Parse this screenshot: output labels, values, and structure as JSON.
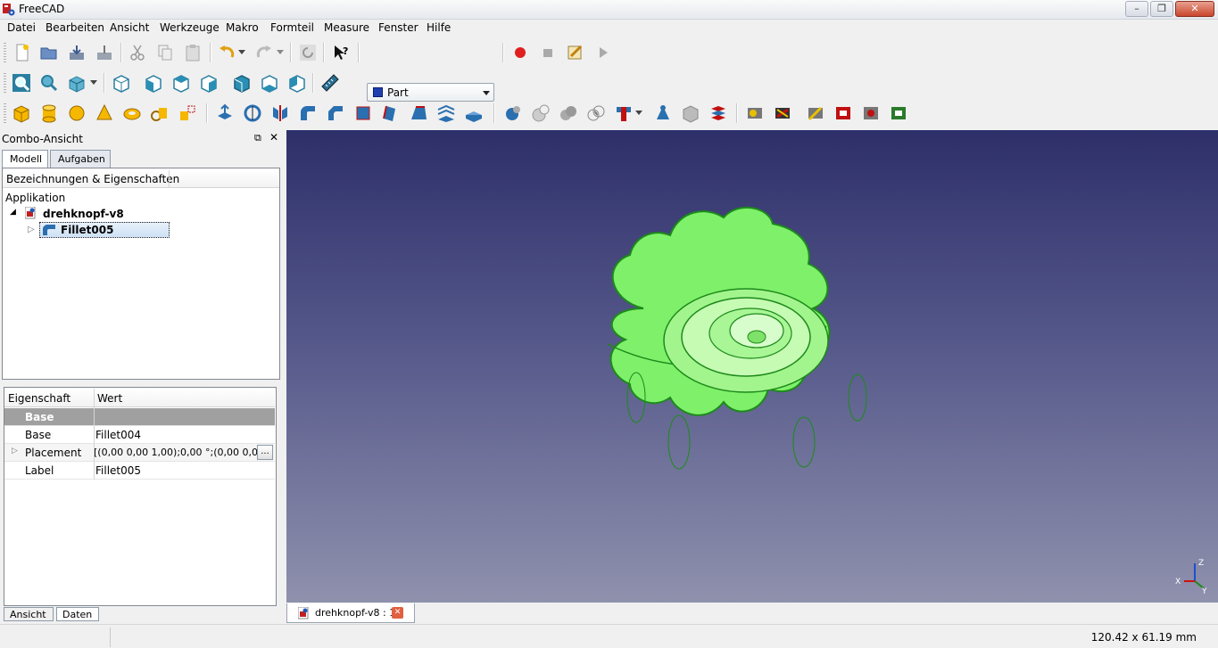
{
  "window": {
    "title": "FreeCAD"
  },
  "menu": [
    "Datei",
    "Bearbeiten",
    "Ansicht",
    "Werkzeuge",
    "Makro",
    "Formteil",
    "Measure",
    "Fenster",
    "Hilfe"
  ],
  "workbench": {
    "selected": "Part"
  },
  "combo": {
    "title": "Combo-Ansicht",
    "tabs": [
      "Modell",
      "Aufgaben"
    ]
  },
  "tree": {
    "header": "Bezeichnungen & Eigenschaften",
    "root": "Applikation",
    "document": "drehknopf-v8",
    "object": "Fillet005"
  },
  "properties": {
    "col_property": "Eigenschaft",
    "col_value": "Wert",
    "group": "Base",
    "rows": [
      {
        "name": "Base",
        "value": "Fillet004"
      },
      {
        "name": "Placement",
        "value": "[(0,00 0,00 1,00);0,00 °;(0,00 0,00 0,0"
      },
      {
        "name": "Label",
        "value": "Fillet005"
      }
    ],
    "ellipsis": "..."
  },
  "bottom_tabs": [
    "Ansicht",
    "Daten"
  ],
  "doc_tab": {
    "label": "drehknopf-v8 : 1"
  },
  "status": {
    "dimensions": "120.42 x 61.19 mm"
  },
  "axis": {
    "x": "X",
    "y": "Y",
    "z": "Z"
  },
  "colors": {
    "model": "#7ef06a",
    "edge": "#1d8a1a",
    "accent": "#c41b1b"
  }
}
